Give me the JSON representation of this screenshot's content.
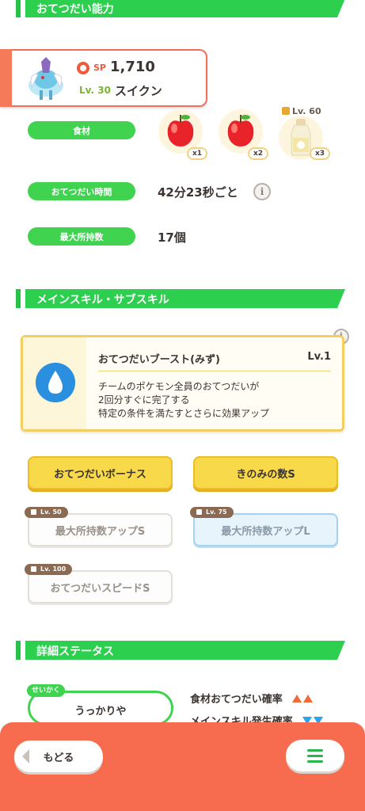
{
  "sections": {
    "ability_title": "おてつだい能力",
    "skill_title": "メインスキル・サブスキル",
    "detail_title": "詳細ステータス"
  },
  "pokemon": {
    "sp_label": "SP",
    "sp_value": "1,710",
    "level": "Lv. 30",
    "name": "スイクン"
  },
  "ingredients": {
    "label": "食材",
    "items": [
      {
        "icon": "apple-icon",
        "count": "x1"
      },
      {
        "icon": "apple-icon",
        "count": "x2"
      },
      {
        "icon": "oil-bottle-icon",
        "count": "x3",
        "unlock": "Lv. 60"
      }
    ]
  },
  "help_time": {
    "label": "おてつだい時間",
    "value": "42分23秒ごと"
  },
  "max_carry": {
    "label": "最大所持数",
    "value": "17個"
  },
  "main_skill": {
    "name": "おてつだいブースト(みず)",
    "level": "Lv.1",
    "description": [
      "チームのポケモン全員のおてつだいが",
      "2回分すぐに完了する",
      "特定の条件を満たすとさらに効果アップ"
    ]
  },
  "sub_skills": [
    {
      "label": "おてつだいボーナス",
      "state": "active"
    },
    {
      "label": "きのみの数S",
      "state": "active"
    },
    {
      "label": "最大所持数アップS",
      "state": "locked",
      "unlock": "Lv. 50"
    },
    {
      "label": "最大所持数アップL",
      "state": "locked-blue",
      "unlock": "Lv. 75"
    },
    {
      "label": "おてつだいスピードS",
      "state": "locked",
      "unlock": "Lv. 100"
    }
  ],
  "detail": {
    "nature_tag": "せいかく",
    "nature_value": "うっかりや",
    "stats": [
      {
        "label": "食材おてつだい確率",
        "direction": "up"
      },
      {
        "label": "メインスキル発生確率",
        "direction": "down"
      }
    ]
  },
  "nav": {
    "back_label": "もどる"
  },
  "colors": {
    "accent_green": "#2dcf4f",
    "accent_orange": "#f76c4f",
    "skill_gold": "#f2cf60"
  }
}
